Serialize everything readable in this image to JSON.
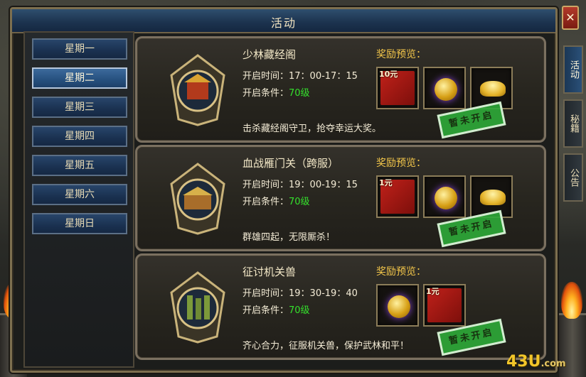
{
  "window": {
    "title": "活动",
    "close_label": "✕"
  },
  "days": [
    "星期一",
    "星期二",
    "星期三",
    "星期四",
    "星期五",
    "星期六",
    "星期日"
  ],
  "active_day_index": 1,
  "side_tabs": [
    {
      "label": "活动",
      "active": true
    },
    {
      "label": "秘籍",
      "active": false
    },
    {
      "label": "公告",
      "active": false
    }
  ],
  "reward_title": "奖励预览：",
  "stamp_text": "暂未开启",
  "activities": [
    {
      "name": "少林藏经阁",
      "time_label": "开启时间：",
      "time": "17：00-17：15",
      "cond_label": "开启条件：",
      "level": "70级",
      "desc": "击杀藏经阁守卫，抢夺幸运大奖。",
      "rewards": [
        {
          "type": "red-envelope",
          "amount": "10元"
        },
        {
          "type": "coin"
        },
        {
          "type": "gold-ingot"
        }
      ]
    },
    {
      "name": "血战雁门关（跨服）",
      "time_label": "开启时间：",
      "time": "19：00-19：15",
      "cond_label": "开启条件：",
      "level": "70级",
      "desc": "群雄四起，无限厮杀！",
      "rewards": [
        {
          "type": "red-envelope",
          "amount": "1元"
        },
        {
          "type": "coin"
        },
        {
          "type": "gold-ingot"
        }
      ]
    },
    {
      "name": "征讨机关兽",
      "time_label": "开启时间：",
      "time": "19：30-19：40",
      "cond_label": "开启条件：",
      "level": "70级",
      "desc": "齐心合力，征服机关兽，保护武林和平！",
      "rewards": [
        {
          "type": "coin"
        },
        {
          "type": "red-envelope",
          "amount": "1元"
        }
      ]
    }
  ],
  "watermark": {
    "brand": "43U",
    "suffix": ".com"
  }
}
